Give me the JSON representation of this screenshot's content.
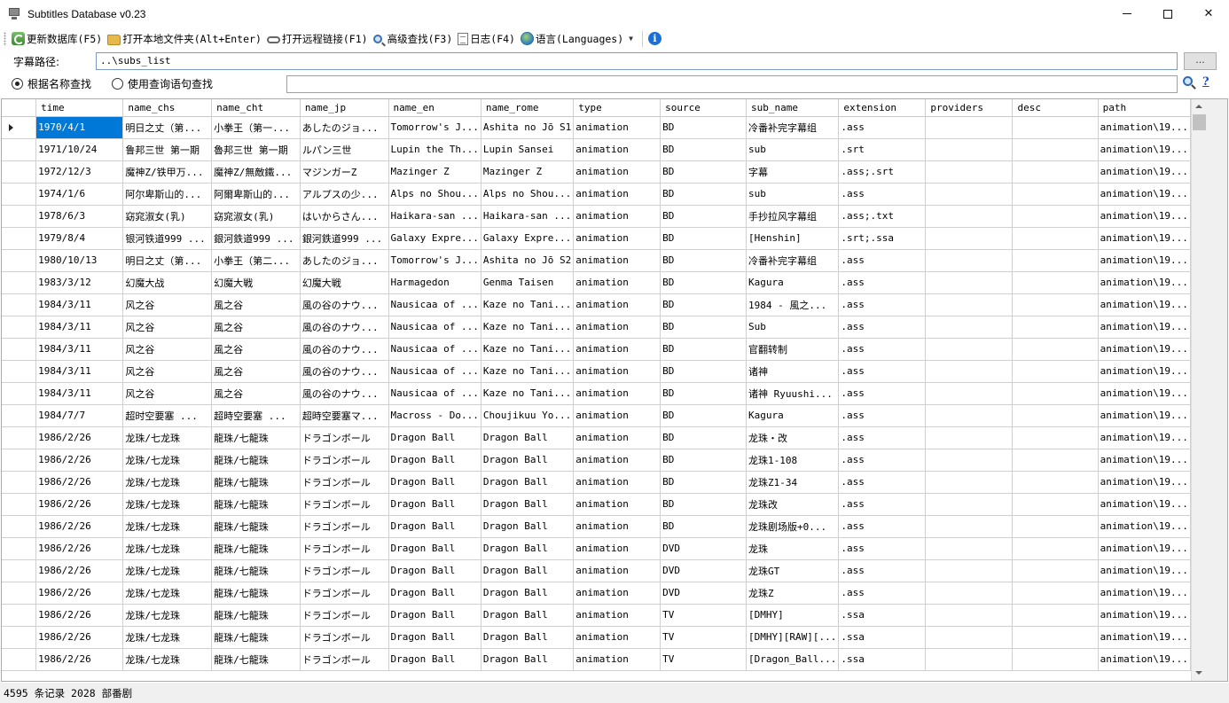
{
  "window": {
    "title": "Subtitles Database v0.23"
  },
  "toolbar": {
    "update_db": "更新数据库(F5)",
    "open_local": "打开本地文件夹(Alt+Enter)",
    "open_remote": "打开远程链接(F1)",
    "advanced_search": "高级查找(F3)",
    "log": "日志(F4)",
    "language": "语言(Languages)"
  },
  "path": {
    "label": "字幕路径:",
    "value": "..\\subs_list",
    "browse_label": "..."
  },
  "search": {
    "mode_name": "根据名称查找",
    "mode_query": "使用查询语句查找",
    "query_value": "",
    "help_label": "?"
  },
  "table": {
    "columns": [
      "time",
      "name_chs",
      "name_cht",
      "name_jp",
      "name_en",
      "name_rome",
      "type",
      "source",
      "sub_name",
      "extension",
      "providers",
      "desc",
      "path"
    ],
    "rows": [
      [
        "1970/4/1",
        "明日之丈（第...",
        "小拳王（第一...",
        "あしたのジョ...",
        "Tomorrow's J...",
        "Ashita no Jō S1",
        "animation",
        "BD",
        "冷番补完字幕组",
        ".ass",
        "",
        "",
        "animation\\19..."
      ],
      [
        "1971/10/24",
        "鲁邦三世 第一期",
        "魯邦三世 第一期",
        "ルパン三世",
        "Lupin the Th...",
        "Lupin Sansei",
        "animation",
        "BD",
        "sub",
        ".srt",
        "",
        "",
        "animation\\19..."
      ],
      [
        "1972/12/3",
        "魔神Z/铁甲万...",
        "魔神Z/無敵鐵...",
        "マジンガーZ",
        "Mazinger Z",
        "Mazinger Z",
        "animation",
        "BD",
        "字幕",
        ".ass;.srt",
        "",
        "",
        "animation\\19..."
      ],
      [
        "1974/1/6",
        "阿尔卑斯山的...",
        "阿爾卑斯山的...",
        "アルプスの少...",
        "Alps no Shou...",
        "Alps no Shou...",
        "animation",
        "BD",
        "sub",
        ".ass",
        "",
        "",
        "animation\\19..."
      ],
      [
        "1978/6/3",
        "窈窕淑女(乳)",
        "窈窕淑女(乳)",
        "はいからさん...",
        "Haikara-san ...",
        "Haikara-san ...",
        "animation",
        "BD",
        "手抄拉风字幕组",
        ".ass;.txt",
        "",
        "",
        "animation\\19..."
      ],
      [
        "1979/8/4",
        "银河铁道999 ...",
        "銀河鉄道999 ...",
        "銀河鉄道999 ...",
        "Galaxy Expre...",
        "Galaxy Expre...",
        "animation",
        "BD",
        "[Henshin]",
        ".srt;.ssa",
        "",
        "",
        "animation\\19..."
      ],
      [
        "1980/10/13",
        "明日之丈（第...",
        "小拳王（第二...",
        "あしたのジョ...",
        "Tomorrow's J...",
        "Ashita no Jō S2",
        "animation",
        "BD",
        "冷番补完字幕组",
        ".ass",
        "",
        "",
        "animation\\19..."
      ],
      [
        "1983/3/12",
        "幻魔大战",
        "幻魔大戦",
        "幻魔大戦",
        "Harmagedon",
        "Genma Taisen",
        "animation",
        "BD",
        "Kagura",
        ".ass",
        "",
        "",
        "animation\\19..."
      ],
      [
        "1984/3/11",
        "风之谷",
        "風之谷",
        "風の谷のナウ...",
        "Nausicaa of ...",
        "Kaze no Tani...",
        "animation",
        "BD",
        "1984 - 風之...",
        ".ass",
        "",
        "",
        "animation\\19..."
      ],
      [
        "1984/3/11",
        "风之谷",
        "風之谷",
        "風の谷のナウ...",
        "Nausicaa of ...",
        "Kaze no Tani...",
        "animation",
        "BD",
        "Sub",
        ".ass",
        "",
        "",
        "animation\\19..."
      ],
      [
        "1984/3/11",
        "风之谷",
        "風之谷",
        "風の谷のナウ...",
        "Nausicaa of ...",
        "Kaze no Tani...",
        "animation",
        "BD",
        "官翻转制",
        ".ass",
        "",
        "",
        "animation\\19..."
      ],
      [
        "1984/3/11",
        "风之谷",
        "風之谷",
        "風の谷のナウ...",
        "Nausicaa of ...",
        "Kaze no Tani...",
        "animation",
        "BD",
        "诸神",
        ".ass",
        "",
        "",
        "animation\\19..."
      ],
      [
        "1984/3/11",
        "风之谷",
        "風之谷",
        "風の谷のナウ...",
        "Nausicaa of ...",
        "Kaze no Tani...",
        "animation",
        "BD",
        "诸神 Ryuushi...",
        ".ass",
        "",
        "",
        "animation\\19..."
      ],
      [
        "1984/7/7",
        "超时空要塞 ...",
        "超時空要塞 ...",
        "超時空要塞マ...",
        "Macross - Do...",
        "Choujikuu Yo...",
        "animation",
        "BD",
        "Kagura",
        ".ass",
        "",
        "",
        "animation\\19..."
      ],
      [
        "1986/2/26",
        "龙珠/七龙珠",
        "龍珠/七龍珠",
        "ドラゴンボール",
        "Dragon Ball",
        "Dragon Ball",
        "animation",
        "BD",
        "龙珠・改",
        ".ass",
        "",
        "",
        "animation\\19..."
      ],
      [
        "1986/2/26",
        "龙珠/七龙珠",
        "龍珠/七龍珠",
        "ドラゴンボール",
        "Dragon Ball",
        "Dragon Ball",
        "animation",
        "BD",
        "龙珠1-108",
        ".ass",
        "",
        "",
        "animation\\19..."
      ],
      [
        "1986/2/26",
        "龙珠/七龙珠",
        "龍珠/七龍珠",
        "ドラゴンボール",
        "Dragon Ball",
        "Dragon Ball",
        "animation",
        "BD",
        "龙珠Z1-34",
        ".ass",
        "",
        "",
        "animation\\19..."
      ],
      [
        "1986/2/26",
        "龙珠/七龙珠",
        "龍珠/七龍珠",
        "ドラゴンボール",
        "Dragon Ball",
        "Dragon Ball",
        "animation",
        "BD",
        "龙珠改",
        ".ass",
        "",
        "",
        "animation\\19..."
      ],
      [
        "1986/2/26",
        "龙珠/七龙珠",
        "龍珠/七龍珠",
        "ドラゴンボール",
        "Dragon Ball",
        "Dragon Ball",
        "animation",
        "BD",
        "龙珠剧场版+0...",
        ".ass",
        "",
        "",
        "animation\\19..."
      ],
      [
        "1986/2/26",
        "龙珠/七龙珠",
        "龍珠/七龍珠",
        "ドラゴンボール",
        "Dragon Ball",
        "Dragon Ball",
        "animation",
        "DVD",
        "龙珠",
        ".ass",
        "",
        "",
        "animation\\19..."
      ],
      [
        "1986/2/26",
        "龙珠/七龙珠",
        "龍珠/七龍珠",
        "ドラゴンボール",
        "Dragon Ball",
        "Dragon Ball",
        "animation",
        "DVD",
        "龙珠GT",
        ".ass",
        "",
        "",
        "animation\\19..."
      ],
      [
        "1986/2/26",
        "龙珠/七龙珠",
        "龍珠/七龍珠",
        "ドラゴンボール",
        "Dragon Ball",
        "Dragon Ball",
        "animation",
        "DVD",
        "龙珠Z",
        ".ass",
        "",
        "",
        "animation\\19..."
      ],
      [
        "1986/2/26",
        "龙珠/七龙珠",
        "龍珠/七龍珠",
        "ドラゴンボール",
        "Dragon Ball",
        "Dragon Ball",
        "animation",
        "TV",
        "[DMHY]",
        ".ssa",
        "",
        "",
        "animation\\19..."
      ],
      [
        "1986/2/26",
        "龙珠/七龙珠",
        "龍珠/七龍珠",
        "ドラゴンボール",
        "Dragon Ball",
        "Dragon Ball",
        "animation",
        "TV",
        "[DMHY][RAW][...",
        ".ssa",
        "",
        "",
        "animation\\19..."
      ],
      [
        "1986/2/26",
        "龙珠/七龙珠",
        "龍珠/七龍珠",
        "ドラゴンボール",
        "Dragon Ball",
        "Dragon Ball",
        "animation",
        "TV",
        "[Dragon_Ball...",
        ".ssa",
        "",
        "",
        "animation\\19..."
      ]
    ]
  },
  "status": {
    "text": "4595 条记录 2028 部番剧"
  }
}
